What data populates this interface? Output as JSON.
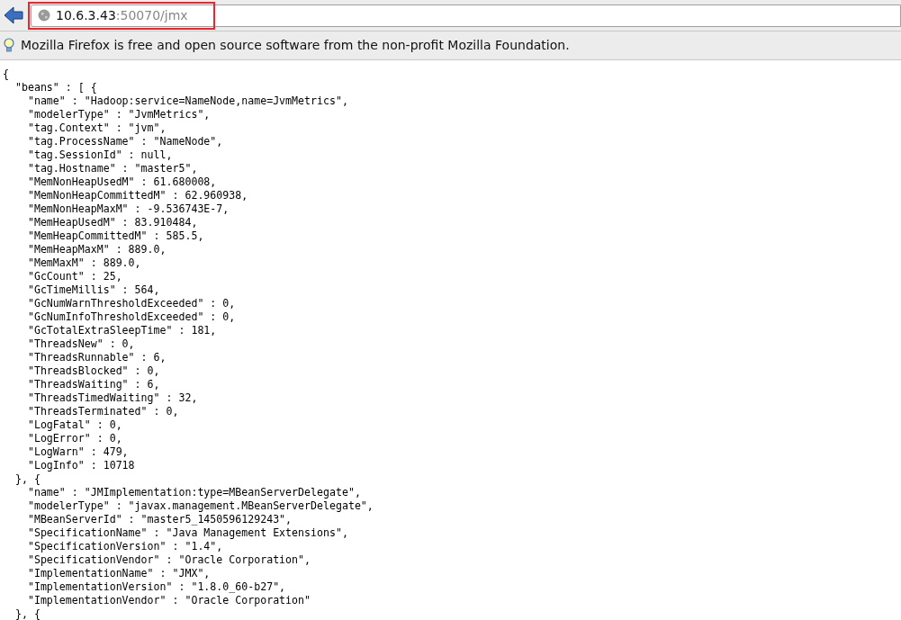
{
  "toolbar": {
    "url_host": "10.6.3.43",
    "url_rest": ":50070/jmx"
  },
  "notification": {
    "text": "Mozilla Firefox is free and open source software from the non-profit Mozilla Foundation."
  },
  "document": {
    "lines": [
      "{",
      "  \"beans\" : [ {",
      "    \"name\" : \"Hadoop:service=NameNode,name=JvmMetrics\",",
      "    \"modelerType\" : \"JvmMetrics\",",
      "    \"tag.Context\" : \"jvm\",",
      "    \"tag.ProcessName\" : \"NameNode\",",
      "    \"tag.SessionId\" : null,",
      "    \"tag.Hostname\" : \"master5\",",
      "    \"MemNonHeapUsedM\" : 61.680008,",
      "    \"MemNonHeapCommittedM\" : 62.960938,",
      "    \"MemNonHeapMaxM\" : -9.536743E-7,",
      "    \"MemHeapUsedM\" : 83.910484,",
      "    \"MemHeapCommittedM\" : 585.5,",
      "    \"MemHeapMaxM\" : 889.0,",
      "    \"MemMaxM\" : 889.0,",
      "    \"GcCount\" : 25,",
      "    \"GcTimeMillis\" : 564,",
      "    \"GcNumWarnThresholdExceeded\" : 0,",
      "    \"GcNumInfoThresholdExceeded\" : 0,",
      "    \"GcTotalExtraSleepTime\" : 181,",
      "    \"ThreadsNew\" : 0,",
      "    \"ThreadsRunnable\" : 6,",
      "    \"ThreadsBlocked\" : 0,",
      "    \"ThreadsWaiting\" : 6,",
      "    \"ThreadsTimedWaiting\" : 32,",
      "    \"ThreadsTerminated\" : 0,",
      "    \"LogFatal\" : 0,",
      "    \"LogError\" : 0,",
      "    \"LogWarn\" : 479,",
      "    \"LogInfo\" : 10718",
      "  }, {",
      "    \"name\" : \"JMImplementation:type=MBeanServerDelegate\",",
      "    \"modelerType\" : \"javax.management.MBeanServerDelegate\",",
      "    \"MBeanServerId\" : \"master5_1450596129243\",",
      "    \"SpecificationName\" : \"Java Management Extensions\",",
      "    \"SpecificationVersion\" : \"1.4\",",
      "    \"SpecificationVendor\" : \"Oracle Corporation\",",
      "    \"ImplementationName\" : \"JMX\",",
      "    \"ImplementationVersion\" : \"1.8.0_60-b27\",",
      "    \"ImplementationVendor\" : \"Oracle Corporation\"",
      "  }, {"
    ]
  }
}
